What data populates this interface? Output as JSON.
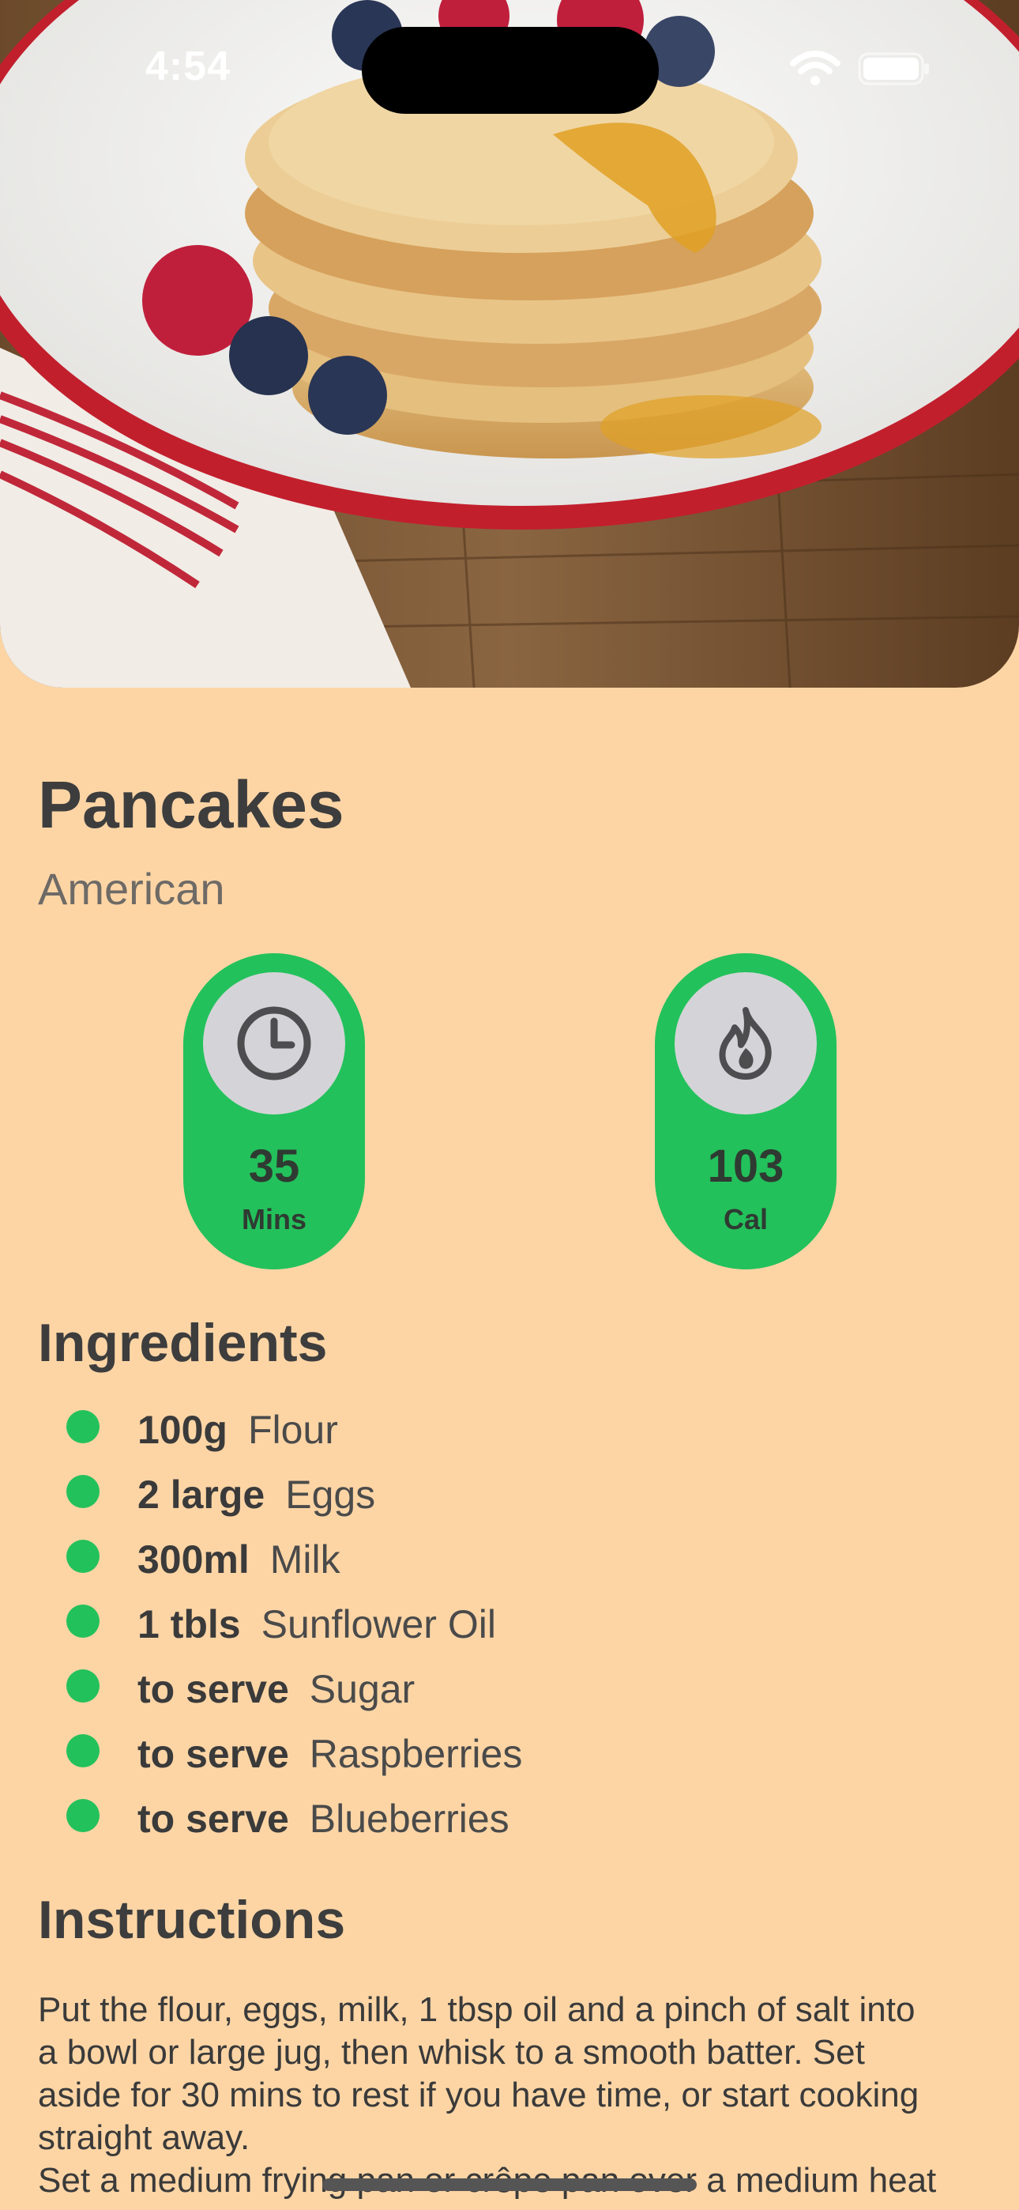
{
  "status_bar": {
    "time": "4:54"
  },
  "recipe": {
    "title": "Pancakes",
    "cuisine": "American"
  },
  "stats": {
    "time": {
      "icon": "clock-icon",
      "value": "35",
      "unit": "Mins"
    },
    "calories": {
      "icon": "flame-icon",
      "value": "103",
      "unit": "Cal"
    }
  },
  "ingredients": {
    "heading": "Ingredients",
    "items": [
      {
        "qty": "100g",
        "name": "Flour"
      },
      {
        "qty": "2 large",
        "name": "Eggs"
      },
      {
        "qty": "300ml",
        "name": "Milk"
      },
      {
        "qty": "1 tbls",
        "name": "Sunflower Oil"
      },
      {
        "qty": "to serve",
        "name": "Sugar"
      },
      {
        "qty": "to serve",
        "name": "Raspberries"
      },
      {
        "qty": "to serve",
        "name": "Blueberries"
      }
    ]
  },
  "instructions": {
    "heading": "Instructions",
    "lines": [
      "Put the flour, eggs, milk, 1 tbsp oil and a pinch of salt into",
      "a bowl or large jug, then whisk to a smooth batter. Set",
      "aside for 30 mins to rest if you have time, or start cooking",
      "straight away.",
      "Set a medium frying pan or crêpe pan over a medium heat"
    ]
  },
  "colors": {
    "background": "#FDD5A5",
    "accent_green": "#23C15B",
    "icon_circle": "#D4D4D8"
  }
}
